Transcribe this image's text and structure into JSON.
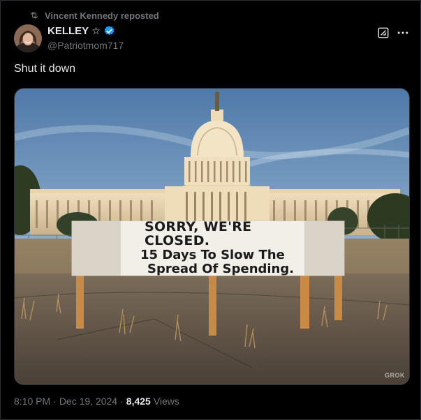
{
  "repost": {
    "text": "Vincent Kennedy reposted"
  },
  "author": {
    "name": "KELLEY",
    "star": "☆",
    "handle": "@Patriotmom717"
  },
  "post": {
    "text": "Shut it down"
  },
  "image": {
    "sign_line1": "SORRY, WE'RE CLOSED.",
    "sign_line2": "15 Days To Slow The",
    "sign_line3": "Spread Of Spending.",
    "watermark": "GROK"
  },
  "meta": {
    "time": "8:10 PM",
    "sep1": "·",
    "date": "Dec 19, 2024",
    "sep2": "·",
    "views_count": "8,425",
    "views_label": "Views"
  },
  "colors": {
    "background": "#000000",
    "text": "#e7e9ea",
    "muted": "#71767b",
    "verified": "#1d9bf0"
  },
  "icons": [
    "repost-icon",
    "verified-badge-icon",
    "grok-icon",
    "more-icon"
  ]
}
